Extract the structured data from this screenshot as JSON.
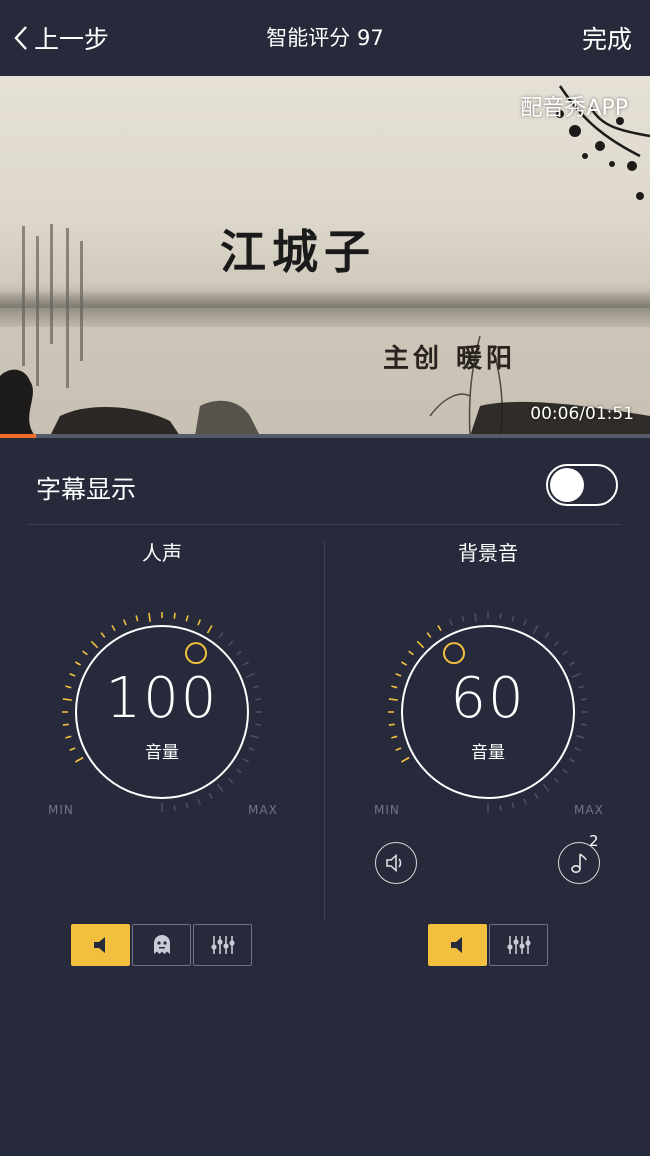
{
  "header": {
    "back_label": "上一步",
    "title": "智能评分 97",
    "done_label": "完成"
  },
  "video": {
    "watermark": "配音秀APP",
    "title_text": "江城子",
    "credit_text": "主创 暖阳",
    "timecode": "00:06/01:51",
    "progress": 0.055
  },
  "subtitle": {
    "label": "字幕显示",
    "enabled": true
  },
  "voice": {
    "label": "人声",
    "value": "100",
    "unit": "音量",
    "min_label": "MIN",
    "max_label": "MAX",
    "level": 1.0,
    "buttons": [
      "speaker-icon",
      "ghost-icon",
      "equalizer-icon"
    ],
    "active_index": 0
  },
  "background": {
    "label": "背景音",
    "value": "60",
    "unit": "音量",
    "min_label": "MIN",
    "max_label": "MAX",
    "level": 0.6,
    "music_badge": "2",
    "buttons": [
      "speaker-icon",
      "equalizer-icon"
    ],
    "active_index": 0
  },
  "colors": {
    "background": "#262a3a",
    "accent": "#f2bf3f",
    "progress": "#f26b2c"
  }
}
